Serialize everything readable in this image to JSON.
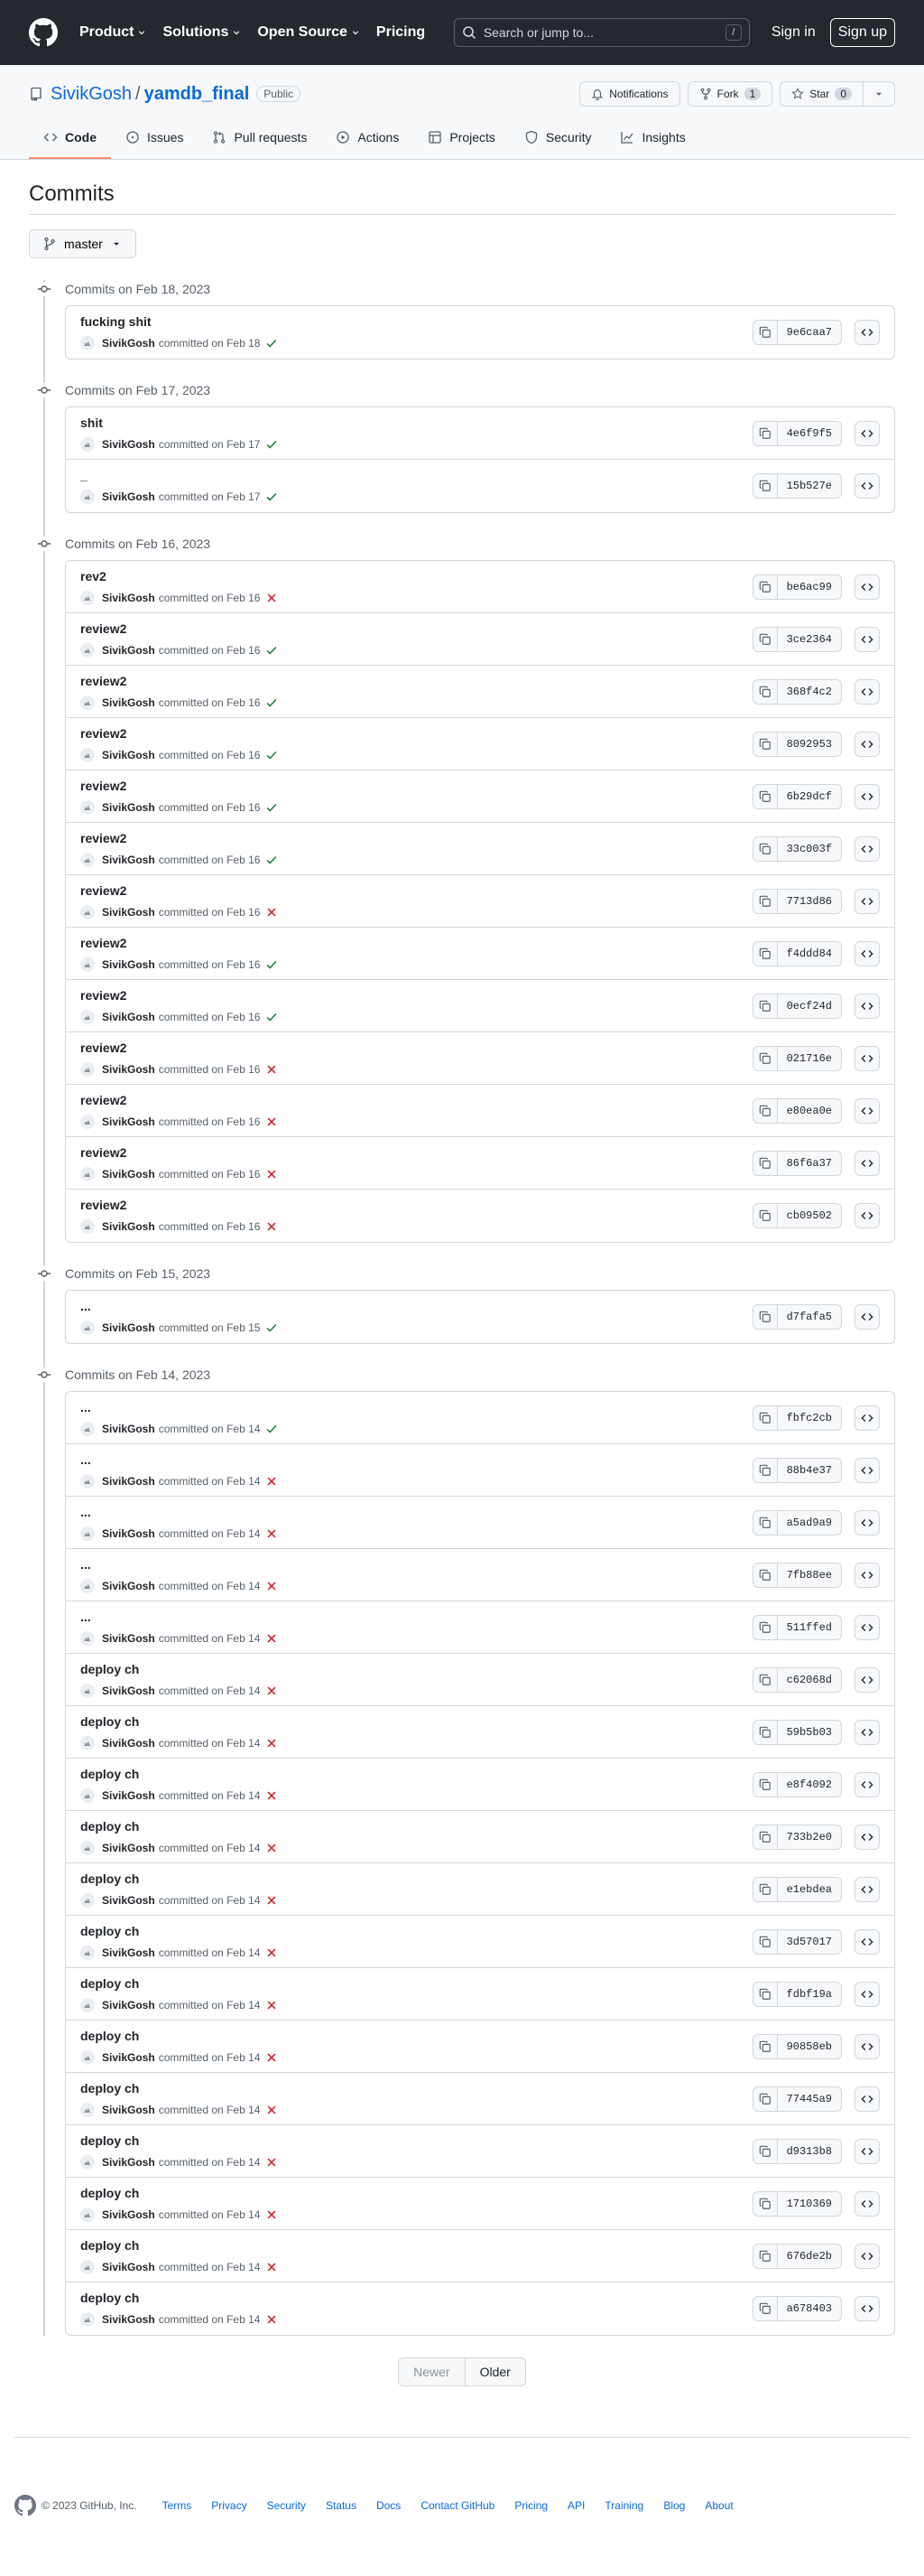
{
  "header": {
    "nav": [
      "Product",
      "Solutions",
      "Open Source",
      "Pricing"
    ],
    "search_placeholder": "Search or jump to...",
    "search_shortcut": "/",
    "signin": "Sign in",
    "signup": "Sign up"
  },
  "repo": {
    "owner": "SivikGosh",
    "separator": "/",
    "name": "yamdb_final",
    "visibility": "Public",
    "notifications_label": "Notifications",
    "fork_label": "Fork",
    "fork_count": "1",
    "star_label": "Star",
    "star_count": "0"
  },
  "tabs": [
    {
      "label": "Code",
      "icon": "code-icon",
      "active": true
    },
    {
      "label": "Issues",
      "icon": "issue-icon",
      "active": false
    },
    {
      "label": "Pull requests",
      "icon": "pull-request-icon",
      "active": false
    },
    {
      "label": "Actions",
      "icon": "play-icon",
      "active": false
    },
    {
      "label": "Projects",
      "icon": "table-icon",
      "active": false
    },
    {
      "label": "Security",
      "icon": "shield-icon",
      "active": false
    },
    {
      "label": "Insights",
      "icon": "graph-icon",
      "active": false
    }
  ],
  "page": {
    "title": "Commits",
    "branch": "master"
  },
  "verb": "committed on",
  "groups": [
    {
      "date_label": "Commits on Feb 18, 2023",
      "commits": [
        {
          "message": "fucking shit",
          "author": "SivikGosh",
          "date": "Feb 18",
          "status": "success",
          "sha": "9e6caa7"
        }
      ]
    },
    {
      "date_label": "Commits on Feb 17, 2023",
      "commits": [
        {
          "message": "shit",
          "author": "SivikGosh",
          "date": "Feb 17",
          "status": "success",
          "sha": "4e6f9f5"
        },
        {
          "message": "_",
          "author": "SivikGosh",
          "date": "Feb 17",
          "status": "success",
          "sha": "15b527e"
        }
      ]
    },
    {
      "date_label": "Commits on Feb 16, 2023",
      "commits": [
        {
          "message": "rev2",
          "author": "SivikGosh",
          "date": "Feb 16",
          "status": "failure",
          "sha": "be6ac99"
        },
        {
          "message": "review2",
          "author": "SivikGosh",
          "date": "Feb 16",
          "status": "success",
          "sha": "3ce2364"
        },
        {
          "message": "review2",
          "author": "SivikGosh",
          "date": "Feb 16",
          "status": "success",
          "sha": "368f4c2"
        },
        {
          "message": "review2",
          "author": "SivikGosh",
          "date": "Feb 16",
          "status": "success",
          "sha": "8092953"
        },
        {
          "message": "review2",
          "author": "SivikGosh",
          "date": "Feb 16",
          "status": "success",
          "sha": "6b29dcf"
        },
        {
          "message": "review2",
          "author": "SivikGosh",
          "date": "Feb 16",
          "status": "success",
          "sha": "33c003f"
        },
        {
          "message": "review2",
          "author": "SivikGosh",
          "date": "Feb 16",
          "status": "failure",
          "sha": "7713d86"
        },
        {
          "message": "review2",
          "author": "SivikGosh",
          "date": "Feb 16",
          "status": "success",
          "sha": "f4ddd84"
        },
        {
          "message": "review2",
          "author": "SivikGosh",
          "date": "Feb 16",
          "status": "success",
          "sha": "0ecf24d"
        },
        {
          "message": "review2",
          "author": "SivikGosh",
          "date": "Feb 16",
          "status": "failure",
          "sha": "021716e"
        },
        {
          "message": "review2",
          "author": "SivikGosh",
          "date": "Feb 16",
          "status": "failure",
          "sha": "e80ea0e"
        },
        {
          "message": "review2",
          "author": "SivikGosh",
          "date": "Feb 16",
          "status": "failure",
          "sha": "86f6a37"
        },
        {
          "message": "review2",
          "author": "SivikGosh",
          "date": "Feb 16",
          "status": "failure",
          "sha": "cb09502"
        }
      ]
    },
    {
      "date_label": "Commits on Feb 15, 2023",
      "commits": [
        {
          "message": "...",
          "author": "SivikGosh",
          "date": "Feb 15",
          "status": "success",
          "sha": "d7fafa5"
        }
      ]
    },
    {
      "date_label": "Commits on Feb 14, 2023",
      "commits": [
        {
          "message": "...",
          "author": "SivikGosh",
          "date": "Feb 14",
          "status": "success",
          "sha": "fbfc2cb"
        },
        {
          "message": "...",
          "author": "SivikGosh",
          "date": "Feb 14",
          "status": "failure",
          "sha": "88b4e37"
        },
        {
          "message": "...",
          "author": "SivikGosh",
          "date": "Feb 14",
          "status": "failure",
          "sha": "a5ad9a9"
        },
        {
          "message": "...",
          "author": "SivikGosh",
          "date": "Feb 14",
          "status": "failure",
          "sha": "7fb88ee"
        },
        {
          "message": "...",
          "author": "SivikGosh",
          "date": "Feb 14",
          "status": "failure",
          "sha": "511ffed"
        },
        {
          "message": "deploy ch",
          "author": "SivikGosh",
          "date": "Feb 14",
          "status": "failure",
          "sha": "c62068d"
        },
        {
          "message": "deploy ch",
          "author": "SivikGosh",
          "date": "Feb 14",
          "status": "failure",
          "sha": "59b5b03"
        },
        {
          "message": "deploy ch",
          "author": "SivikGosh",
          "date": "Feb 14",
          "status": "failure",
          "sha": "e8f4092"
        },
        {
          "message": "deploy ch",
          "author": "SivikGosh",
          "date": "Feb 14",
          "status": "failure",
          "sha": "733b2e0"
        },
        {
          "message": "deploy ch",
          "author": "SivikGosh",
          "date": "Feb 14",
          "status": "failure",
          "sha": "e1ebdea"
        },
        {
          "message": "deploy ch",
          "author": "SivikGosh",
          "date": "Feb 14",
          "status": "failure",
          "sha": "3d57017"
        },
        {
          "message": "deploy ch",
          "author": "SivikGosh",
          "date": "Feb 14",
          "status": "failure",
          "sha": "fdbf19a"
        },
        {
          "message": "deploy ch",
          "author": "SivikGosh",
          "date": "Feb 14",
          "status": "failure",
          "sha": "90858eb"
        },
        {
          "message": "deploy ch",
          "author": "SivikGosh",
          "date": "Feb 14",
          "status": "failure",
          "sha": "77445a9"
        },
        {
          "message": "deploy ch",
          "author": "SivikGosh",
          "date": "Feb 14",
          "status": "failure",
          "sha": "d9313b8"
        },
        {
          "message": "deploy ch",
          "author": "SivikGosh",
          "date": "Feb 14",
          "status": "failure",
          "sha": "1710369"
        },
        {
          "message": "deploy ch",
          "author": "SivikGosh",
          "date": "Feb 14",
          "status": "failure",
          "sha": "676de2b"
        },
        {
          "message": "deploy ch",
          "author": "SivikGosh",
          "date": "Feb 14",
          "status": "failure",
          "sha": "a678403"
        }
      ]
    }
  ],
  "pagination": {
    "newer": "Newer",
    "older": "Older"
  },
  "footer": {
    "copyright": "© 2023 GitHub, Inc.",
    "links": [
      "Terms",
      "Privacy",
      "Security",
      "Status",
      "Docs",
      "Contact GitHub",
      "Pricing",
      "API",
      "Training",
      "Blog",
      "About"
    ]
  },
  "colors": {
    "header_bg": "#24292f",
    "link": "#0969da",
    "success": "#1a7f37",
    "failure": "#cf222e",
    "active_tab_underline": "#fd8c73"
  }
}
